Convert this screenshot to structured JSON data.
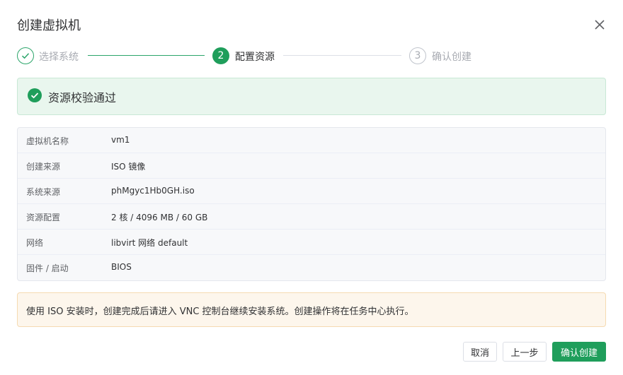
{
  "dialog": {
    "title": "创建虚拟机",
    "close_icon": "close-icon"
  },
  "steps": [
    {
      "number": "1",
      "label": "选择系统",
      "status": "done",
      "icon": "check-icon"
    },
    {
      "number": "2",
      "label": "配置资源",
      "status": "active"
    },
    {
      "number": "3",
      "label": "确认创建",
      "status": "pending"
    }
  ],
  "success_alert": {
    "icon": "check-circle-icon",
    "text": "资源校验通过"
  },
  "summary": [
    {
      "key": "虚拟机名称",
      "value": "vm1"
    },
    {
      "key": "创建来源",
      "value": "ISO 镜像"
    },
    {
      "key": "系统来源",
      "value": "phMgyc1Hb0GH.iso"
    },
    {
      "key": "资源配置",
      "value": "2 核 / 4096 MB / 60 GB"
    },
    {
      "key": "网络",
      "value": "libvirt 网络 default"
    },
    {
      "key": "固件 / 启动",
      "value": "BIOS"
    }
  ],
  "warning_alert": {
    "text": "使用 ISO 安装时，创建完成后请进入 VNC 控制台继续安装系统。创建操作将在任务中心执行。"
  },
  "footer": {
    "cancel_label": "取消",
    "prev_label": "上一步",
    "confirm_label": "确认创建"
  },
  "colors": {
    "accent": "#1f9e5b",
    "success_bg": "#e9f6ee",
    "warning_bg": "#fdf6ec"
  }
}
